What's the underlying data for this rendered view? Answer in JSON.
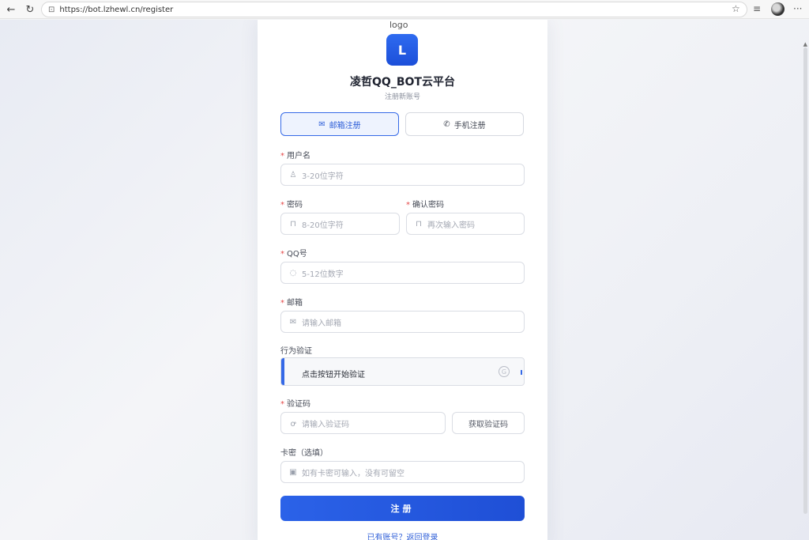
{
  "browser": {
    "url": "https://bot.lzhewl.cn/register"
  },
  "page": {
    "logo_alt": "logo",
    "logo_letter": "L",
    "title": "凌哲QQ_BOT云平台",
    "subtitle": "注册新账号",
    "tabs": [
      {
        "label": "邮箱注册",
        "icon": "mail-icon",
        "active": true
      },
      {
        "label": "手机注册",
        "icon": "phone-icon",
        "active": false
      }
    ],
    "fields": {
      "username": {
        "label": "用户名",
        "placeholder": "3-20位字符",
        "required": true
      },
      "password": {
        "label": "密码",
        "placeholder": "8-20位字符",
        "required": true
      },
      "confirm": {
        "label": "确认密码",
        "placeholder": "再次输入密码",
        "required": true
      },
      "qq": {
        "label": "QQ号",
        "placeholder": "5-12位数字",
        "required": true
      },
      "email": {
        "label": "邮箱",
        "placeholder": "请输入邮箱",
        "required": true
      },
      "captcha": {
        "label": "行为验证",
        "prompt": "点击按钮开始验证"
      },
      "code": {
        "label": "验证码",
        "placeholder": "请输入验证码",
        "required": true,
        "button": "获取验证码"
      },
      "card": {
        "label": "卡密（选填）",
        "placeholder": "如有卡密可输入，没有可留空"
      }
    },
    "submit_label": "注册",
    "login_link": "已有账号？返回登录"
  },
  "colors": {
    "accent": "#3569e7",
    "required": "#e54848"
  }
}
